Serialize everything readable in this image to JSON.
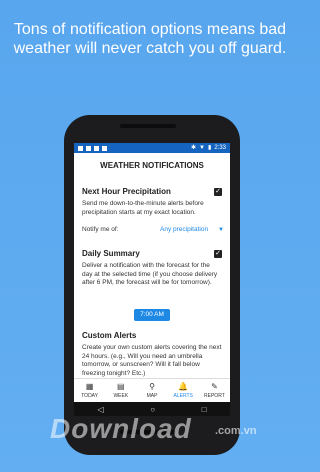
{
  "headline": "Tons of notification options means bad weather will never catch you off guard.",
  "status": {
    "time": "2:33"
  },
  "screen": {
    "title": "WEATHER NOTIFICATIONS",
    "precip": {
      "title": "Next Hour Precipitation",
      "desc": "Send me down-to-the-minute alerts before precipitation starts at my exact location.",
      "notify_label": "Notify me of:",
      "notify_value": "Any precipitation"
    },
    "daily": {
      "title": "Daily Summary",
      "desc": "Deliver a notification with the forecast for the day at the selected time (if you choose delivery after 6 PM, the forecast will be for tomorrow).",
      "time_button": "7:00 AM"
    },
    "custom": {
      "title": "Custom Alerts",
      "desc": "Create your own custom alerts covering the next 24 hours. (e.g., Will you need an umbrella tomorrow, or sunscreen? Will it fall below freezing tonight? Etc.)"
    }
  },
  "bottom_nav": [
    {
      "label": "TODAY"
    },
    {
      "label": "WEEK"
    },
    {
      "label": "MAP"
    },
    {
      "label": "ALERTS"
    },
    {
      "label": "REPORT"
    }
  ],
  "watermark": {
    "text": "Download",
    "domain": ".com.vn"
  }
}
